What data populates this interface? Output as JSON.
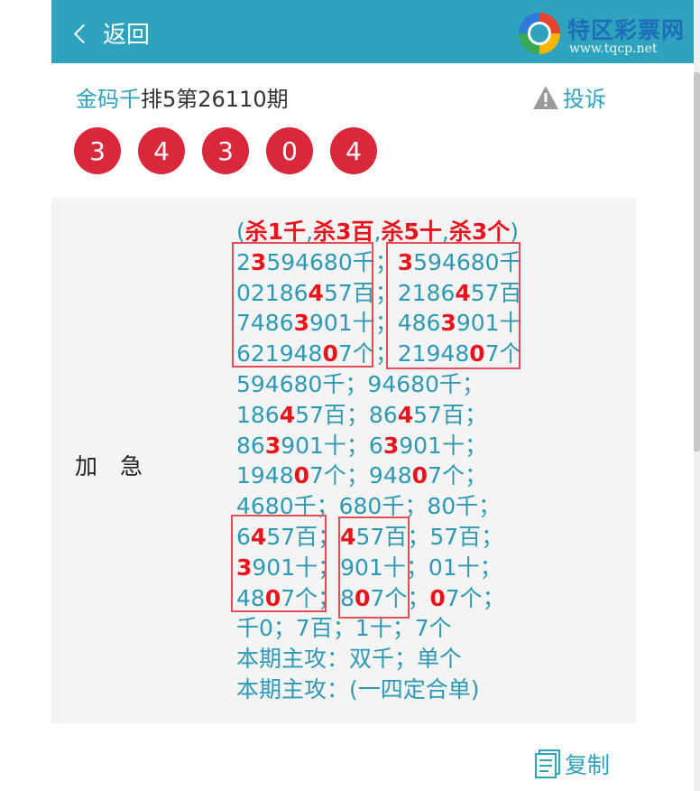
{
  "header": {
    "back_label": "返回"
  },
  "logo": {
    "name": "特区彩票网",
    "url": "www.tqcp.net"
  },
  "title": {
    "brand": "金码千",
    "rest": "排5第26110期"
  },
  "complain_label": "投诉",
  "balls": [
    "3",
    "4",
    "3",
    "0",
    "4"
  ],
  "panel": {
    "label": "加　急"
  },
  "lines": [
    [
      [
        "n",
        "("
      ],
      [
        "r",
        "杀1千"
      ],
      [
        "n",
        ","
      ],
      [
        "r",
        "杀3百"
      ],
      [
        "n",
        ","
      ],
      [
        "r",
        "杀5十"
      ],
      [
        "n",
        ","
      ],
      [
        "r",
        "杀3个"
      ],
      [
        "n",
        ")"
      ]
    ],
    [
      [
        "n",
        "2"
      ],
      [
        "r",
        "3"
      ],
      [
        "n",
        "594680千；"
      ],
      [
        "r",
        "3"
      ],
      [
        "n",
        "594680千"
      ]
    ],
    [
      [
        "n",
        "02186"
      ],
      [
        "r",
        "4"
      ],
      [
        "n",
        "57百；"
      ],
      [
        "n",
        "2186"
      ],
      [
        "r",
        "4"
      ],
      [
        "n",
        "57百"
      ]
    ],
    [
      [
        "n",
        "7486"
      ],
      [
        "r",
        "3"
      ],
      [
        "n",
        "901十；"
      ],
      [
        "n",
        "486"
      ],
      [
        "r",
        "3"
      ],
      [
        "n",
        "901十"
      ]
    ],
    [
      [
        "n",
        "621948"
      ],
      [
        "r",
        "0"
      ],
      [
        "n",
        "7个；"
      ],
      [
        "n",
        "21948"
      ],
      [
        "r",
        "0"
      ],
      [
        "n",
        "7个"
      ]
    ],
    [
      [
        "n",
        "594680千；94680千；"
      ]
    ],
    [
      [
        "n",
        "186"
      ],
      [
        "r",
        "4"
      ],
      [
        "n",
        "57百；86"
      ],
      [
        "r",
        "4"
      ],
      [
        "n",
        "57百；"
      ]
    ],
    [
      [
        "n",
        "86"
      ],
      [
        "r",
        "3"
      ],
      [
        "n",
        "901十；6"
      ],
      [
        "r",
        "3"
      ],
      [
        "n",
        "901十；"
      ]
    ],
    [
      [
        "n",
        "1948"
      ],
      [
        "r",
        "0"
      ],
      [
        "n",
        "7个；948"
      ],
      [
        "r",
        "0"
      ],
      [
        "n",
        "7个；"
      ]
    ],
    [
      [
        "n",
        "4680千；680千；80千；"
      ]
    ],
    [
      [
        "n",
        "6"
      ],
      [
        "r",
        "4"
      ],
      [
        "n",
        "57百；"
      ],
      [
        "r",
        "4"
      ],
      [
        "n",
        "57百；57百；"
      ]
    ],
    [
      [
        "r",
        "3"
      ],
      [
        "n",
        "901十；901十；01十；"
      ]
    ],
    [
      [
        "n",
        "48"
      ],
      [
        "r",
        "0"
      ],
      [
        "n",
        "7个；8"
      ],
      [
        "r",
        "0"
      ],
      [
        "n",
        "7个；"
      ],
      [
        "r",
        "0"
      ],
      [
        "n",
        "7个；"
      ]
    ],
    [
      [
        "n",
        "千0；7百；1十；7个"
      ]
    ],
    [
      [
        "n",
        "本期主攻：双千；单个"
      ]
    ],
    [
      [
        "n",
        "本期主攻：(一四定合单)"
      ]
    ]
  ],
  "copy_label": "复制",
  "colors": {
    "accent": "#2fa3bd",
    "ball": "#d9283b",
    "highlight": "#e8141d",
    "box": "#e34d53"
  }
}
